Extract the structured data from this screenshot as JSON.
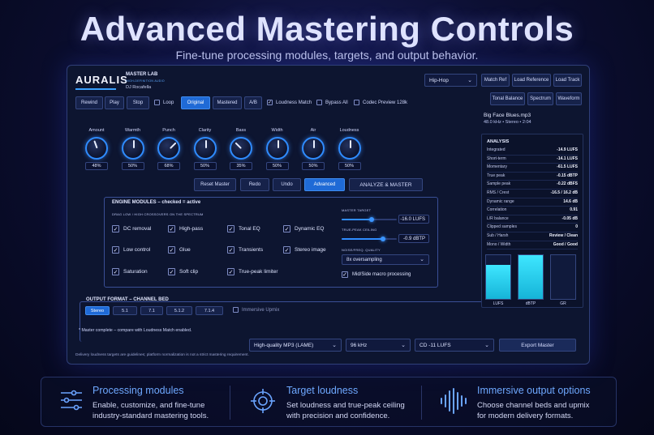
{
  "hero": {
    "title": "Advanced Mastering Controls",
    "subtitle": "Fine-tune processing modules, targets, and output behavior."
  },
  "app": {
    "brand": "AURALIS",
    "project_title": "MASTER LAB",
    "project_tag": "HIGH-DEFINITION AUDIO",
    "artist": "DJ Rocafella"
  },
  "top_right": {
    "genre_select": "Hip-Hop",
    "buttons": [
      "Match Ref",
      "Load Reference",
      "Load Track"
    ],
    "view_buttons": [
      "Tonal Balance",
      "Spectrum",
      "Waveform"
    ]
  },
  "transport": {
    "rewind": "Rewind",
    "play": "Play",
    "stop": "Stop",
    "loop": "Loop",
    "original": "Original",
    "mastered": "Mastered",
    "ab": "A/B",
    "loudness_match": "Loudness Match",
    "bypass_all": "Bypass All",
    "codec_preview": "Codec Preview 128k"
  },
  "file_info": {
    "name": "Big Face Blues.mp3",
    "details": "48.0 kHz  •  Stereo  •  2:04"
  },
  "knobs": [
    {
      "label": "Amount",
      "value": "48%",
      "angle": -20
    },
    {
      "label": "Warmth",
      "value": "50%",
      "angle": 0
    },
    {
      "label": "Punch",
      "value": "68%",
      "angle": 45
    },
    {
      "label": "Clarity",
      "value": "50%",
      "angle": 0
    },
    {
      "label": "Bass",
      "value": "35%",
      "angle": -45
    },
    {
      "label": "Width",
      "value": "50%",
      "angle": 0
    },
    {
      "label": "Air",
      "value": "50%",
      "angle": 0
    },
    {
      "label": "Loudness",
      "value": "50%",
      "angle": 0
    }
  ],
  "actions": {
    "reset": "Reset Master",
    "redo": "Redo",
    "undo": "Undo",
    "advanced": "Advanced",
    "analyze": "ANALYZE & MASTER"
  },
  "engine": {
    "title": "ENGINE MODULES – checked = active",
    "caption": "DRAG LOW / HIGH CROSSOVERS ON THE SPECTRUM",
    "modules": [
      "DC removal",
      "High-pass",
      "Tonal EQ",
      "Dynamic EQ",
      "Low control",
      "Glue",
      "Transients",
      "Stereo image",
      "Saturation",
      "Soft clip",
      "True-peak limiter"
    ],
    "master_target_label": "MASTER TARGET",
    "master_target_value": "-16.0 LUFS",
    "master_target_level": 0.55,
    "true_peak_label": "TRUE-PEAK CEILING",
    "true_peak_value": "-0.9 dBTP",
    "true_peak_level": 0.75,
    "oversampling_label": "NOISE/FREQ. QUALITY",
    "oversampling_value": "8x oversampling",
    "midside_label": "Mid/Side macro processing"
  },
  "output_format": {
    "title": "OUTPUT FORMAT – CHANNEL BED",
    "options": [
      "Stereo",
      "5.1",
      "7.1",
      "5.1.2",
      "7.1.4"
    ],
    "selected": "Stereo",
    "upmix_label": "Immersive Upmix"
  },
  "status": {
    "message": "* Master complete – compare with Loudness Match enabled.",
    "footnote": "Delivery loudness targets are guidelines; platform normalization is not a strict mastering requirement."
  },
  "export": {
    "codec": "High-quality MP3 (LAME)",
    "rate": "96 kHz",
    "target": "CD  -11 LUFS",
    "button": "Export Master"
  },
  "analysis": {
    "title": "ANALYSIS",
    "rows": [
      {
        "label": "Integrated",
        "value": "-14.9 LUFS"
      },
      {
        "label": "Short-term",
        "value": "-14.1 LUFS"
      },
      {
        "label": "Momentary",
        "value": "-61.5 LUFS"
      },
      {
        "label": "True peak",
        "value": "-0.15 dBTP"
      },
      {
        "label": "Sample peak",
        "value": "-0.22 dBFS"
      },
      {
        "label": "RMS / Crest",
        "value": "-16.5 / 16.2 dB"
      },
      {
        "label": "Dynamic range",
        "value": "14.6 dB"
      },
      {
        "label": "Correlation",
        "value": "0.91"
      },
      {
        "label": "L/R balance",
        "value": "-0.05 dB"
      },
      {
        "label": "Clipped samples",
        "value": "0"
      },
      {
        "label": "Sub / Harsh",
        "value": "Review / Clean"
      },
      {
        "label": "Mono / Width",
        "value": "Good / Good"
      }
    ],
    "meters": [
      {
        "label": "LUFS",
        "level": 0.78
      },
      {
        "label": "dBTP",
        "level": 1.0
      },
      {
        "label": "GR",
        "level": 0.0
      }
    ]
  },
  "features": [
    {
      "title": "Processing modules",
      "desc1": "Enable, customize, and fine-tune",
      "desc2": "industry-standard mastering tools.",
      "icon": "sliders-icon"
    },
    {
      "title": "Target loudness",
      "desc1": "Set loudness and true-peak ceiling",
      "desc2": "with precision and confidence.",
      "icon": "crosshair-icon"
    },
    {
      "title": "Immersive output options",
      "desc1": "Choose channel beds and upmix",
      "desc2": "for modern delivery formats.",
      "icon": "waveform-icon"
    }
  ],
  "colors": {
    "accent": "#1f6ad6",
    "meter": "#3ee6ff",
    "feature_title": "#6ea8ff"
  }
}
